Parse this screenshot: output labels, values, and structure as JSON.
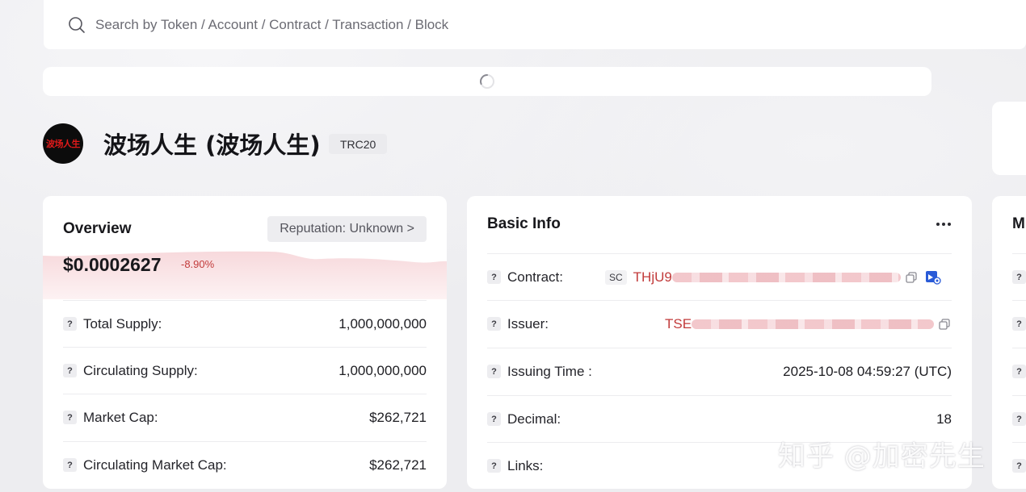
{
  "search": {
    "placeholder": "Search by Token / Account / Contract / Transaction / Block"
  },
  "token": {
    "logo_text": "波场人生",
    "name": "波场人生 (波场人生)",
    "standard": "TRC20"
  },
  "overview": {
    "title": "Overview",
    "reputation": "Reputation: Unknown >",
    "price": "$0.0002627",
    "change": "-8.90%",
    "rows": [
      {
        "label": "Total Supply:",
        "value": "1,000,000,000"
      },
      {
        "label": "Circulating Supply:",
        "value": "1,000,000,000"
      },
      {
        "label": "Market Cap:",
        "value": "$262,721"
      },
      {
        "label": "Circulating Market Cap:",
        "value": "$262,721"
      }
    ]
  },
  "basic_info": {
    "title": "Basic Info",
    "contract": {
      "label": "Contract:",
      "badge": "SC",
      "address_visible": "THjU9"
    },
    "issuer": {
      "label": "Issuer:",
      "address_visible": "TSE"
    },
    "issuing_time": {
      "label": "Issuing Time :",
      "value": "2025-10-08 04:59:27 (UTC)"
    },
    "decimal": {
      "label": "Decimal:",
      "value": "18"
    },
    "links": {
      "label": "Links:",
      "value": "-"
    }
  },
  "market": {
    "title": "M"
  },
  "help_glyph": "?",
  "watermark": "知乎 @加密先生",
  "colors": {
    "negative": "#c23b3b",
    "card_bg": "#ffffff",
    "page_bg": "#ededf0",
    "contract_icon": "#2a5bd7"
  }
}
